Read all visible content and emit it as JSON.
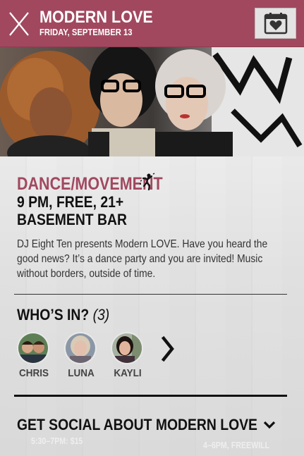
{
  "header": {
    "title": "MODERN LOVE",
    "date": "FRIDAY, SEPTEMBER 13",
    "accent_color": "#a1485f",
    "close_icon": "close-icon",
    "calendar_icon": "calendar-heart-icon"
  },
  "event": {
    "category": "DANCE/MOVEMENT",
    "category_icon": "dancer-icon",
    "time_price_age": "9 PM, FREE, 21+",
    "venue": "BASEMENT BAR",
    "description": "DJ Eight Ten presents Modern LOVE. Have you heard the good news? It’s a dance party and you are invited! Music without borders, outside of time."
  },
  "attendees": {
    "heading": "WHO’S IN?",
    "count": "(3)",
    "people": [
      {
        "name": "CHRIS"
      },
      {
        "name": "LUNA"
      },
      {
        "name": "KAYLI"
      }
    ],
    "next_icon": "chevron-right-icon"
  },
  "social": {
    "label": "GET SOCIAL ABOUT MODERN LOVE",
    "icon": "chevron-down-icon"
  },
  "background": {
    "ghost_left": "5:30–7PM: $15",
    "ghost_right": "4–6PM, FREEWILL"
  }
}
